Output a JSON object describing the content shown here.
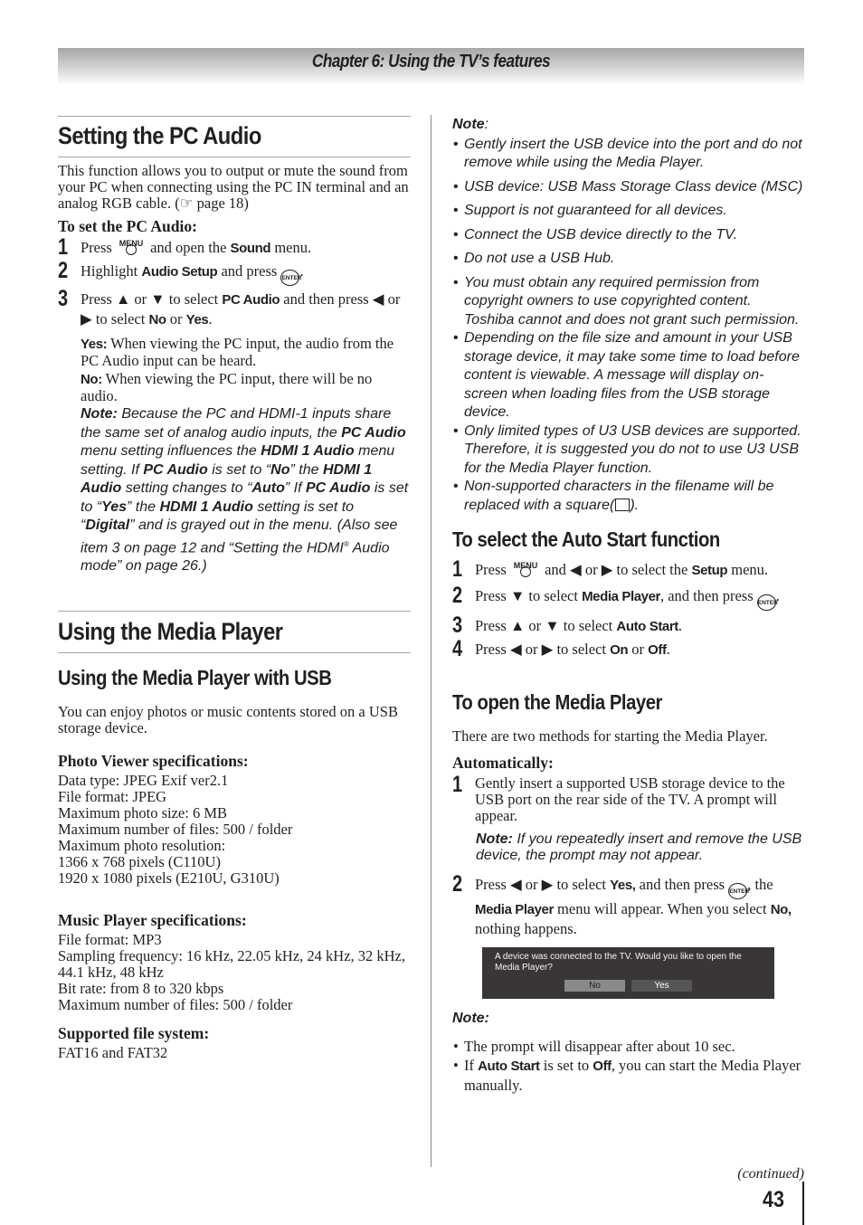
{
  "header": {
    "chapter_title": "Chapter 6: Using the TV’s features"
  },
  "pc_audio": {
    "title": "Setting the PC Audio",
    "intro": "This function allows you to output or mute the sound from your PC when connecting using the PC IN terminal and an analog RGB cable. (☞ page 18)",
    "subhead": "To set the PC Audio:",
    "steps": [
      {
        "num": "1",
        "pre": "Press",
        "icon": "MENU",
        "mid": "and open the",
        "bold": "Sound",
        "post": "menu."
      },
      {
        "num": "2",
        "pre": "Highlight",
        "bold": "Audio Setup",
        "mid": "and press",
        "icon": "ENTER",
        "post": "."
      },
      {
        "num": "3",
        "pre": "Press ▲ or ▼ to select",
        "bold": "PC Audio",
        "mid": "and then press ◀ or ▶ to select",
        "opt1": "No",
        "or": "or",
        "opt2": "Yes",
        "post": "."
      }
    ],
    "yes_label": "Yes:",
    "yes_text": "When viewing the PC input, the audio from the PC Audio input can be heard.",
    "no_label": "No:",
    "no_text": "When viewing the PC input, there will be no audio.",
    "note": {
      "label": "Note:",
      "t1": "Because the PC and HDMI-1 inputs share the same set of analog audio inputs, the",
      "b1": "PC Audio",
      "t2": "menu setting influences the",
      "b2": "HDMI 1 Audio",
      "t3": "menu setting. If",
      "b3": "PC Audio",
      "t4": "is set to “",
      "b4": "No",
      "t5": "” the",
      "b5": "HDMI 1 Audio",
      "t6": "setting changes to “",
      "b6": "Auto",
      "t7": "” If",
      "b7": "PC Audio",
      "t8": "is set to “",
      "b8": "Yes",
      "t9": "” the",
      "b9": "HDMI 1 Audio",
      "t10": "setting is set to “",
      "b10": "Digital",
      "t11": "” and is grayed out in the menu. (Also see item 3 on page 12 and “Setting the HDMI",
      "reg": "®",
      "t12": "Audio mode” on page 26.)"
    }
  },
  "media_player": {
    "title": "Using the Media Player",
    "usb_title": "Using the Media Player with USB",
    "usb_intro": "You can enjoy photos or music contents stored on a USB storage device.",
    "photo_specs": {
      "heading": "Photo Viewer specifications:",
      "lines": [
        "Data type: JPEG Exif ver2.1",
        "File format: JPEG",
        "Maximum photo size: 6 MB",
        "Maximum number of files: 500 / folder",
        "Maximum photo resolution:",
        "1366 x 768 pixels (C110U)",
        "1920 x 1080 pixels (E210U, G310U)"
      ]
    },
    "music_specs": {
      "heading": "Music Player specifications:",
      "lines": [
        "File format: MP3",
        "Sampling frequency: 16 kHz, 22.05 kHz, 24 kHz, 32 kHz, 44.1 kHz, 48 kHz",
        "Bit rate: from 8 to 320 kbps",
        "Maximum number of files: 500 / folder"
      ]
    },
    "file_system": {
      "heading": "Supported file system:",
      "value": "FAT16 and FAT32"
    }
  },
  "usb_note": {
    "label": "Note",
    "colon": ":",
    "items": [
      "Gently insert the USB device into the port and do not remove while using the Media Player.",
      "USB device: USB Mass Storage Class device (MSC)",
      "Support is not guaranteed for all devices.",
      "Connect the USB device directly to the TV.",
      "Do not use a USB Hub.",
      "You must obtain any required permission from copyright owners to use copyrighted content. Toshiba cannot and does not grant such permission.",
      "Depending on the file size and amount in your USB storage device, it may take some time to load before content is viewable. A message will display on-screen when loading files from the USB storage device.",
      "Only limited types of U3 USB devices are supported. Therefore, it is suggested you do not to use U3 USB for the Media Player function.",
      "Non-supported characters in the filename will be replaced with a square("
    ],
    "last_suffix": ")."
  },
  "auto_start": {
    "title": "To select the Auto Start function",
    "steps": [
      {
        "num": "1",
        "pre": "Press",
        "icon": "MENU",
        "mid": "and ◀ or ▶ to select the",
        "bold": "Setup",
        "post": "menu."
      },
      {
        "num": "2",
        "pre": "Press ▼ to select",
        "bold": "Media Player",
        "mid": ", and then press",
        "icon": "ENTER",
        "post": "."
      },
      {
        "num": "3",
        "pre": "Press ▲ or ▼ to select",
        "bold": "Auto Start",
        "post": "."
      },
      {
        "num": "4",
        "pre": "Press ◀ or ▶ to select",
        "opt1": "On",
        "or": "or",
        "opt2": "Off",
        "post": "."
      }
    ]
  },
  "open_player": {
    "title": "To open the Media Player",
    "intro": "There are two methods for starting the Media Player.",
    "subhead": "Automatically:",
    "step1": {
      "num": "1",
      "text": "Gently insert a supported USB storage device to the USB port on the rear side of the TV. A prompt will appear."
    },
    "step1_note": {
      "label": "Note:",
      "text": "If you repeatedly insert and remove the USB device, the prompt may not appear."
    },
    "step2": {
      "num": "2",
      "pre": "Press ◀ or ▶ to select",
      "b1": "Yes,",
      "mid": "and then press",
      "icon": "ENTER",
      "t2": ", the",
      "b2": "Media Player",
      "t3": "menu will appear. When you select",
      "b3": "No,",
      "t4": "nothing happens."
    },
    "prompt": {
      "message": "A device was connected to the TV. Would you like to open the Media Player?",
      "no_label": "No",
      "yes_label": "Yes"
    },
    "note_label": "Note:",
    "notes": [
      {
        "text": "The prompt will disappear after about 10 sec."
      },
      {
        "pre": "If",
        "b1": "Auto Start",
        "mid": "is set to",
        "b2": "Off",
        "post": ", you can start the Media Player manually."
      }
    ]
  },
  "footer": {
    "continued": "(continued)",
    "page_number": "43"
  }
}
